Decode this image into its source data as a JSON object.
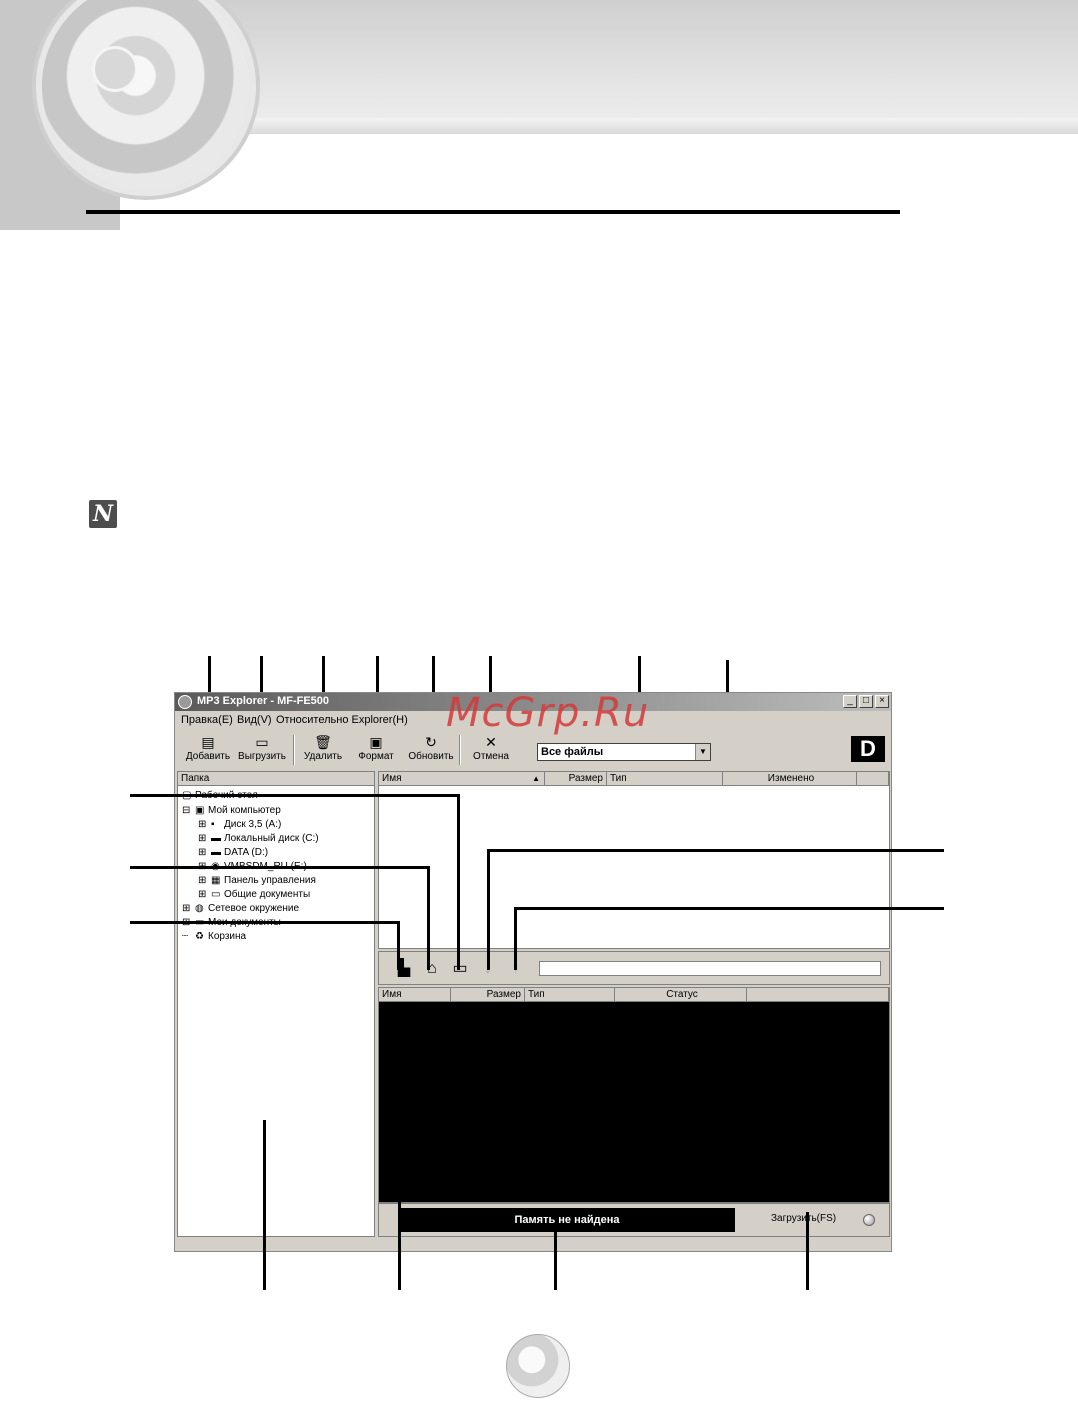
{
  "window": {
    "title": "MP3 Explorer - MF-FE500",
    "controls": [
      "_",
      "□",
      "×"
    ]
  },
  "menu": [
    "Правка(E)",
    "Вид(V)",
    "Относительно Explorer(H)"
  ],
  "toolbar": {
    "buttons": [
      {
        "label": "Добавить",
        "icon": "add-file-icon"
      },
      {
        "label": "Выгрузить",
        "icon": "upload-icon"
      },
      {
        "label": "Удалить",
        "icon": "trash-icon"
      },
      {
        "label": "Формат",
        "icon": "format-icon"
      },
      {
        "label": "Обновить",
        "icon": "refresh-icon"
      },
      {
        "label": "Отмена",
        "icon": "cancel-icon"
      }
    ],
    "filter_value": "Все файлы",
    "logo_letter": "D"
  },
  "folder_pane": {
    "header": "Папка",
    "items": [
      "Рабочий стол",
      "Мой компьютер",
      "Диск 3,5 (A:)",
      "Локальный диск (C:)",
      "DATA (D:)",
      "VMBSDM_RU (E:)",
      "Панель управления",
      "Общие документы",
      "Сетевое окружение",
      "Мои документы",
      "Корзина"
    ]
  },
  "pc_list": {
    "columns": [
      "Имя",
      "Размер",
      "Тип",
      "Изменено"
    ]
  },
  "device_list": {
    "columns": [
      "Имя",
      "Размер",
      "Тип",
      "Статус"
    ]
  },
  "status": {
    "memory": "Память не найдена",
    "upload": "Загрузить(FS)"
  },
  "watermark": "McGrp.Ru",
  "note_icon_letter": "N"
}
